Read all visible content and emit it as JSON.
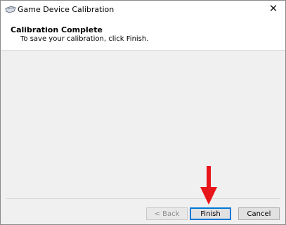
{
  "window": {
    "title": "Game Device Calibration",
    "close_glyph": "✕"
  },
  "header": {
    "title": "Calibration Complete",
    "subtitle": "To save your calibration, click Finish."
  },
  "buttons": {
    "back": "< Back",
    "finish": "Finish",
    "cancel": "Cancel"
  },
  "icons": {
    "app": "game-controller-icon",
    "close": "close-icon",
    "annotation": "red-arrow-icon"
  },
  "colors": {
    "annotation_arrow": "#e8151b",
    "focus_border": "#0078d7"
  }
}
